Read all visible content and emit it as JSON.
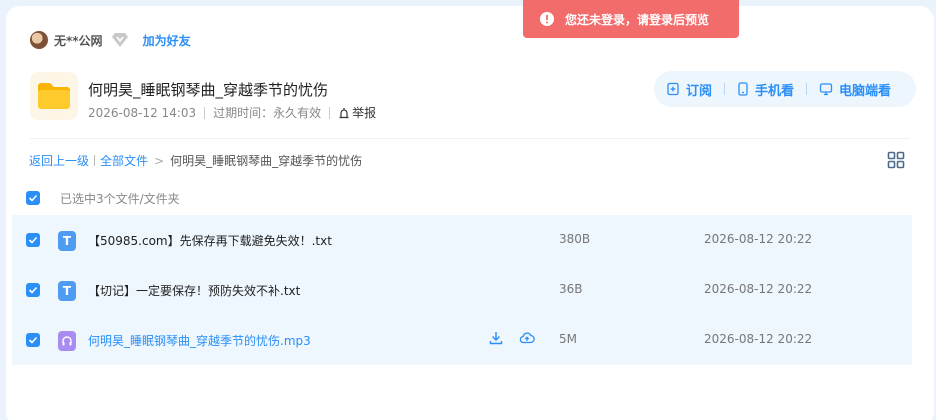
{
  "user": {
    "name": "无**公网",
    "add_friend": "加为好友"
  },
  "share": {
    "title": "何明昊_睡眠钢琴曲_穿越季节的忧伤",
    "date": "2026-08-12 14:03",
    "expire": "过期时间：永久有效",
    "report": "举报"
  },
  "actions": {
    "subscribe": "订阅",
    "mobile": "手机看",
    "desktop": "电脑端看"
  },
  "breadcrumb": {
    "back": "返回上一级",
    "all": "全部文件",
    "sep": ">",
    "current": "何明昊_睡眠钢琴曲_穿越季节的忧伤"
  },
  "selection": {
    "text": "已选中3个文件/文件夹"
  },
  "files": [
    {
      "name": "【50985.com】先保存再下载避免失效！.txt",
      "size": "380B",
      "date": "2026-08-12 20:22",
      "icon": "txt-file-icon",
      "glyph": "T"
    },
    {
      "name": "【切记】一定要保存！预防失效不补.txt",
      "size": "36B",
      "date": "2026-08-12 20:22",
      "icon": "txt-file-icon",
      "glyph": "T"
    },
    {
      "name": "何明昊_睡眠钢琴曲_穿越季节的忧伤.mp3",
      "size": "5M",
      "date": "2026-08-12 20:22",
      "icon": "audio-file-icon",
      "glyph": "∩"
    }
  ],
  "toast": {
    "text": "您还未登录，请登录后预览"
  },
  "colors": {
    "accent": "#2a8ff7",
    "toast": "#f36c6c",
    "row_bg": "#eef6fe"
  }
}
